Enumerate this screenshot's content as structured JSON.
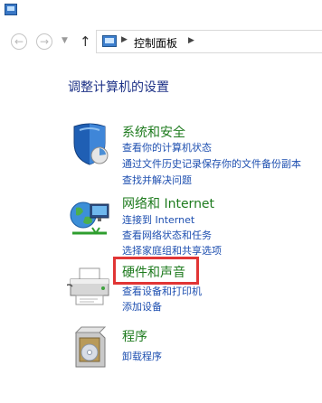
{
  "address_bar": {
    "location": "控制面板"
  },
  "page": {
    "title": "调整计算机的设置"
  },
  "categories": [
    {
      "title": "系统和安全",
      "links": [
        "查看你的计算机状态",
        "通过文件历史记录保存你的文件备份副本",
        "查找并解决问题"
      ],
      "icon": "shield-icon"
    },
    {
      "title": "网络和 Internet",
      "links": [
        "连接到 Internet",
        "查看网络状态和任务",
        "选择家庭组和共享选项"
      ],
      "icon": "network-globe-icon"
    },
    {
      "title": "硬件和声音",
      "links": [
        "查看设备和打印机",
        "添加设备"
      ],
      "icon": "printer-icon",
      "highlighted": true
    },
    {
      "title": "程序",
      "links": [
        "卸载程序"
      ],
      "icon": "programs-box-icon"
    }
  ],
  "colors": {
    "category_title": "#1e7b1e",
    "link": "#1e4fb0",
    "page_title": "#1e3287",
    "highlight": "#e13535"
  }
}
